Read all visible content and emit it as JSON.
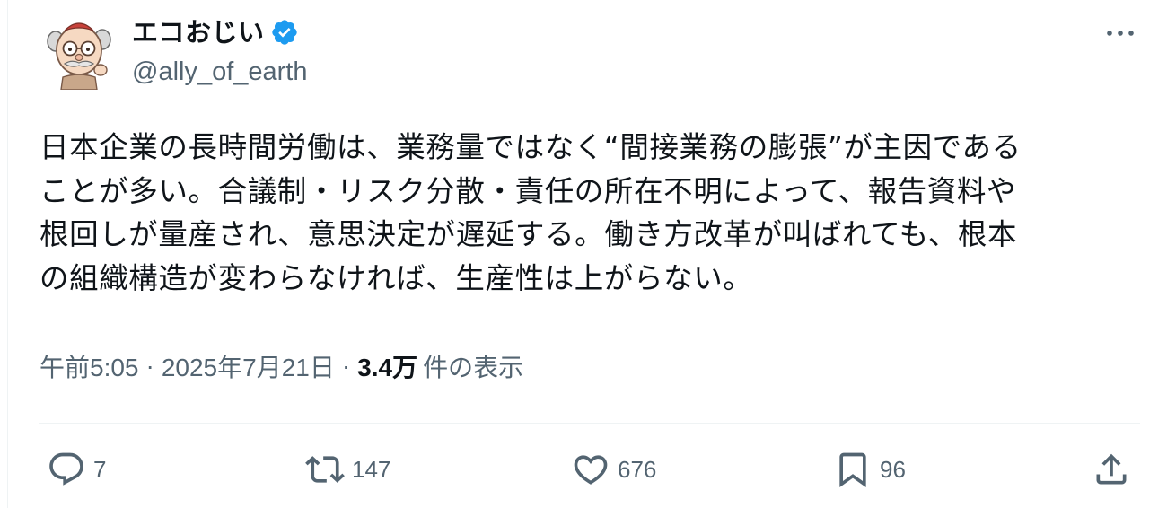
{
  "author": {
    "display_name": "エコおじい",
    "handle": "@ally_of_earth",
    "verified": true,
    "avatar_icon": "avatar-cartoon-old-man"
  },
  "tweet": {
    "text": "日本企業の長時間労働は、業務量ではなく“間接業務の膨張”が主因である\nことが多い。合議制・リスク分散・責任の所在不明によって、報告資料や\n根回しが量産され、意思決定が遅延する。働き方改革が叫ばれても、根本\nの組織構造が変わらなければ、生産性は上がらない。"
  },
  "meta": {
    "time": "午前5:05",
    "separator": "·",
    "date": "2025年7月21日",
    "views_count": "3.4万",
    "views_label": "件の表示"
  },
  "actions": {
    "reply_count": "7",
    "retweet_count": "147",
    "like_count": "676",
    "bookmark_count": "96"
  },
  "colors": {
    "text_primary": "#0f1419",
    "text_secondary": "#536471",
    "verified_blue": "#1d9bf0",
    "divider": "#eff3f4"
  }
}
